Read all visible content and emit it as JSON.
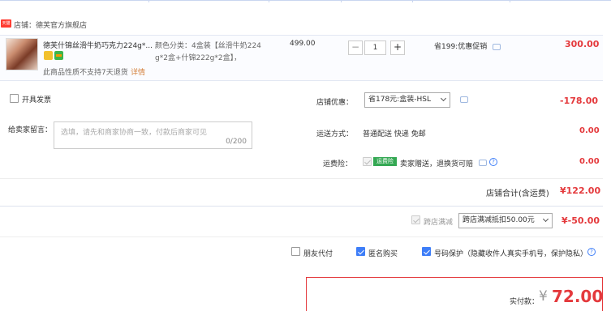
{
  "shop": {
    "icon_text": "天猫",
    "name": "店铺：德芙官方旗舰店"
  },
  "item": {
    "title": "德芙什锦丝滑牛奶巧克力224g*...",
    "spec_line1": "颜色分类：4盒装【丝滑牛奶224",
    "spec_line2": "g*2盒+什锦222g*2盒】，",
    "notice": "此商品性质不支持7天退货",
    "notice_link": "详情",
    "price": "499.00",
    "quantity": "1",
    "minus": "−",
    "plus": "+",
    "promo": "省199:优惠促销",
    "subtotal": "300.00"
  },
  "invoice": {
    "label": "开具发票"
  },
  "shop_discount": {
    "label": "店铺优惠：",
    "selected": "省178元:盒装-HSL",
    "amount": "-178.00"
  },
  "message": {
    "label": "给卖家留言：",
    "placeholder": "选填，请先和商家协商一致，付款后商家可见",
    "counter": "0/200"
  },
  "shipping": {
    "label": "运送方式：",
    "value": "普通配送 快递 免邮",
    "amount": "0.00"
  },
  "insurance": {
    "label": "运费险：",
    "badge": "运费险",
    "text": "卖家赠送，退换货可赔",
    "help": "?",
    "amount": "0.00"
  },
  "shop_total": {
    "label": "店铺合计(含运费)",
    "value": "¥122.00"
  },
  "cross_store": {
    "label": "跨店满减",
    "selected": "跨店满减抵扣50.00元",
    "amount": "¥-50.00"
  },
  "options": {
    "friend_pay": "朋友代付",
    "anonymous": "匿名购买",
    "privacy": "号码保护（隐藏收件人真实手机号，保护隐私）",
    "help": "?"
  },
  "payment": {
    "label": "实付款：",
    "currency": "¥",
    "amount": "72.00"
  },
  "colors": {
    "accent_red": "#e4393c",
    "checkbox_blue": "#3e7ef8",
    "insurance_green": "#34a853"
  }
}
